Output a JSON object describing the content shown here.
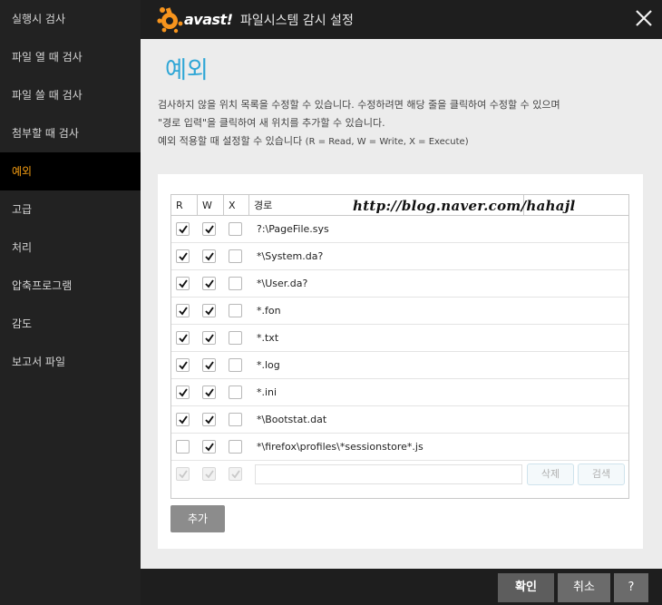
{
  "window": {
    "title": "파일시스템 감시 설정",
    "brand": "avast!"
  },
  "sidebar": {
    "items": [
      {
        "label": "실행시 검사",
        "active": false
      },
      {
        "label": "파일 열 때 검사",
        "active": false
      },
      {
        "label": "파일 쓸 때 검사",
        "active": false
      },
      {
        "label": "첨부할 때 검사",
        "active": false
      },
      {
        "label": "예외",
        "active": true
      },
      {
        "label": "고급",
        "active": false
      },
      {
        "label": "처리",
        "active": false
      },
      {
        "label": "압축프로그램",
        "active": false
      },
      {
        "label": "감도",
        "active": false
      },
      {
        "label": "보고서 파일",
        "active": false
      }
    ]
  },
  "main": {
    "heading": "예외",
    "description": {
      "line1": "검사하지 않을 위치 목록을 수정할 수 있습니다. 수정하려면 해당 줄을 클릭하여 수정할 수 있으며",
      "line2": "\"경로 입력\"을 클릭하여 새 위치를 추가할 수 있습니다.",
      "line3_main": "예외 적용할 때 설정할 수 있습니다 ",
      "line3_note": "(R = Read, W = Write, X = Execute)"
    },
    "table": {
      "headers": {
        "r": "R",
        "w": "W",
        "x": "X",
        "path": "경로",
        "extra": ""
      },
      "rows": [
        {
          "r": true,
          "w": true,
          "x": false,
          "path": "?:\\PageFile.sys"
        },
        {
          "r": true,
          "w": true,
          "x": false,
          "path": "*\\System.da?"
        },
        {
          "r": true,
          "w": true,
          "x": false,
          "path": "*\\User.da?"
        },
        {
          "r": true,
          "w": true,
          "x": false,
          "path": "*.fon"
        },
        {
          "r": true,
          "w": true,
          "x": false,
          "path": "*.txt"
        },
        {
          "r": true,
          "w": true,
          "x": false,
          "path": "*.log"
        },
        {
          "r": true,
          "w": true,
          "x": false,
          "path": "*.ini"
        },
        {
          "r": true,
          "w": true,
          "x": false,
          "path": "*\\Bootstat.dat"
        },
        {
          "r": false,
          "w": true,
          "x": false,
          "path": "*\\firefox\\profiles\\*sessionstore*.js"
        }
      ],
      "new_row": {
        "path_value": "",
        "delete_label": "삭제",
        "browse_label": "검색"
      }
    },
    "add_label": "추가",
    "watermark": "http://blog.naver.com/hahajl"
  },
  "footer": {
    "ok_label": "확인",
    "cancel_label": "취소",
    "help_label": "?"
  },
  "colors": {
    "accent_blue": "#2ea6d6",
    "active_orange": "#f39c12",
    "logo_orange": "#f7941d"
  }
}
